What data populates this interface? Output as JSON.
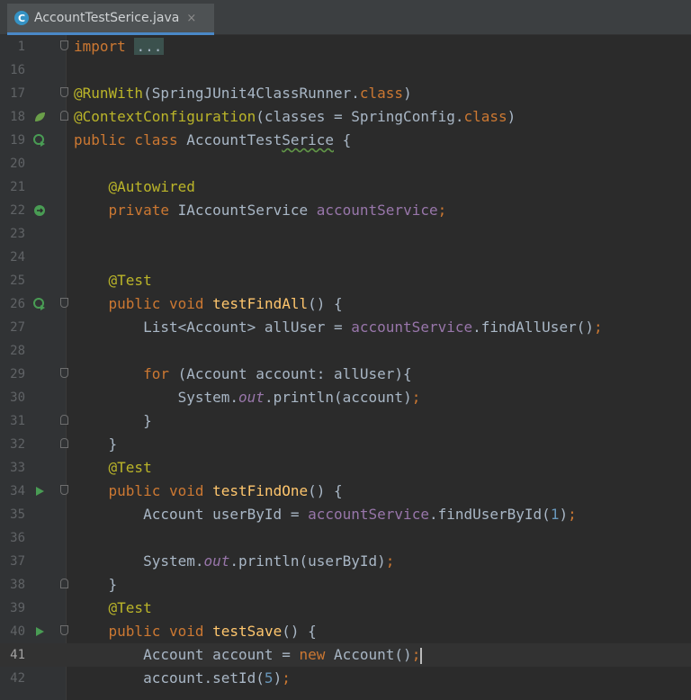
{
  "tab": {
    "title": "AccountTestSerice.java",
    "close": "×",
    "icon_letter": "C"
  },
  "gutter_icons": {
    "run": "run-test-icon",
    "bean": "spring-bean-icon",
    "fold": "fold-marker-icon"
  },
  "colors": {
    "background": "#2b2b2b",
    "keyword": "#cc7832",
    "annotation": "#bbb529",
    "field": "#9876aa",
    "number": "#6897bb",
    "text": "#a9b7c6"
  },
  "lines": [
    {
      "no": "1",
      "t": [
        "import",
        "..."
      ]
    },
    {
      "no": "16"
    },
    {
      "no": "17",
      "t": [
        "@RunWith",
        "(SpringJUnit4ClassRunner.",
        "class",
        ")"
      ]
    },
    {
      "no": "18",
      "t": [
        "@ContextConfiguration",
        "(classes = SpringConfig.",
        "class",
        ")"
      ]
    },
    {
      "no": "19",
      "t": [
        "public class",
        "AccountTest",
        "Serice",
        " {"
      ]
    },
    {
      "no": "20"
    },
    {
      "no": "21",
      "t": [
        "@Autowired"
      ]
    },
    {
      "no": "22",
      "t": [
        "private",
        " IAccountService ",
        "accountService",
        ";"
      ]
    },
    {
      "no": "23"
    },
    {
      "no": "24"
    },
    {
      "no": "25",
      "t": [
        "@Test"
      ]
    },
    {
      "no": "26",
      "t": [
        "public void",
        "testFindAll",
        "() {"
      ]
    },
    {
      "no": "27",
      "t": [
        "List<Account> allUser = ",
        "accountService",
        ".findAllUser()",
        ";"
      ]
    },
    {
      "no": "28"
    },
    {
      "no": "29",
      "t": [
        "for",
        " (Account account: allUser){"
      ]
    },
    {
      "no": "30",
      "t": [
        "System.",
        "out",
        ".println(account)",
        ";"
      ]
    },
    {
      "no": "31",
      "t": [
        "}"
      ]
    },
    {
      "no": "32",
      "t": [
        "}"
      ]
    },
    {
      "no": "33",
      "t": [
        "@Test"
      ]
    },
    {
      "no": "34",
      "t": [
        "public void",
        "testFindOne",
        "() {"
      ]
    },
    {
      "no": "35",
      "t": [
        "Account userById = ",
        "accountService",
        ".findUserById(",
        "1",
        ")",
        ";"
      ]
    },
    {
      "no": "36"
    },
    {
      "no": "37",
      "t": [
        "System.",
        "out",
        ".println(userById)",
        ";"
      ]
    },
    {
      "no": "38",
      "t": [
        "}"
      ]
    },
    {
      "no": "39",
      "t": [
        "@Test"
      ]
    },
    {
      "no": "40",
      "t": [
        "public void",
        "testSave",
        "() {"
      ]
    },
    {
      "no": "41",
      "t": [
        "Account account = ",
        "new",
        " Account()",
        ";"
      ]
    },
    {
      "no": "42",
      "t": [
        "account.setId(",
        "5",
        ")",
        ";"
      ]
    }
  ]
}
